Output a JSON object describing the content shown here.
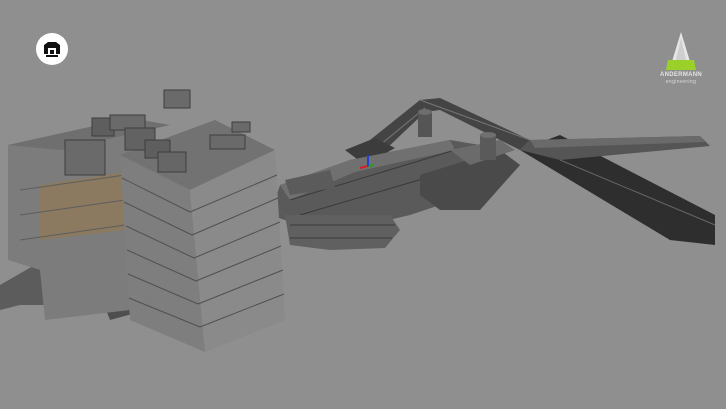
{
  "viewer": {
    "background": "#8f8f8f",
    "tool_icon": "home-view-icon",
    "brand": {
      "name": "ANDERMANN",
      "sub": "engineering",
      "accent": "#9bcf2a"
    },
    "axis_colors": {
      "x": "#d42020",
      "y": "#20a020",
      "z": "#2040d0"
    }
  }
}
